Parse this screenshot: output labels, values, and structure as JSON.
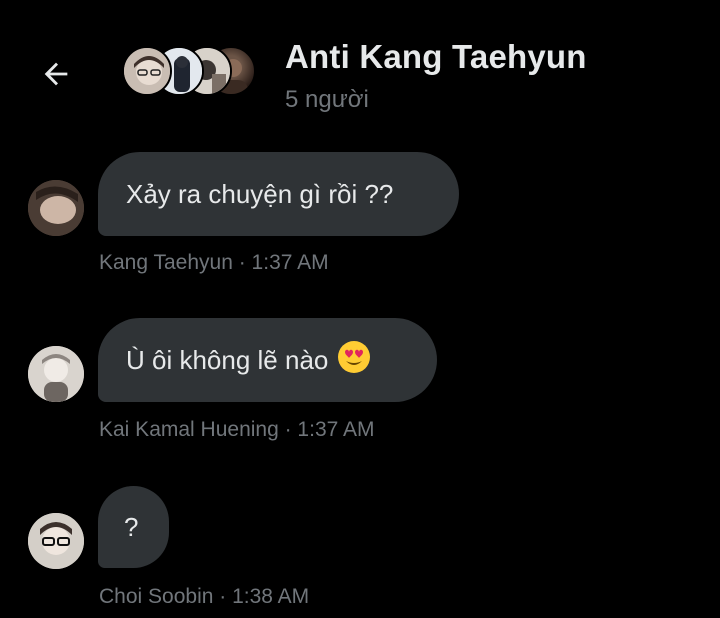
{
  "header": {
    "back_label": "Back",
    "title": "Anti Kang Taehyun",
    "member_count": "5 người",
    "avatars": [
      "member-1",
      "member-2",
      "member-3",
      "member-4"
    ]
  },
  "messages": [
    {
      "text": "Xảy ra chuyện gì rồi ??",
      "sender": "Kang Taehyun",
      "time": "1:37 AM",
      "meta": "Kang Taehyun · 1:37 AM"
    },
    {
      "text": "Ù ôi không lẽ nào",
      "emoji": "smiling-face-with-heart-eyes",
      "sender": "Kai Kamal Huening",
      "time": "1:37 AM",
      "meta": "Kai Kamal Huening · 1:37 AM"
    },
    {
      "text": "?",
      "sender": "Choi Soobin",
      "time": "1:38 AM",
      "meta": "Choi Soobin · 1:38 AM"
    }
  ],
  "colors": {
    "background": "#000000",
    "bubble": "#2f3336",
    "text": "#e7e9ea",
    "muted": "#71767b"
  }
}
